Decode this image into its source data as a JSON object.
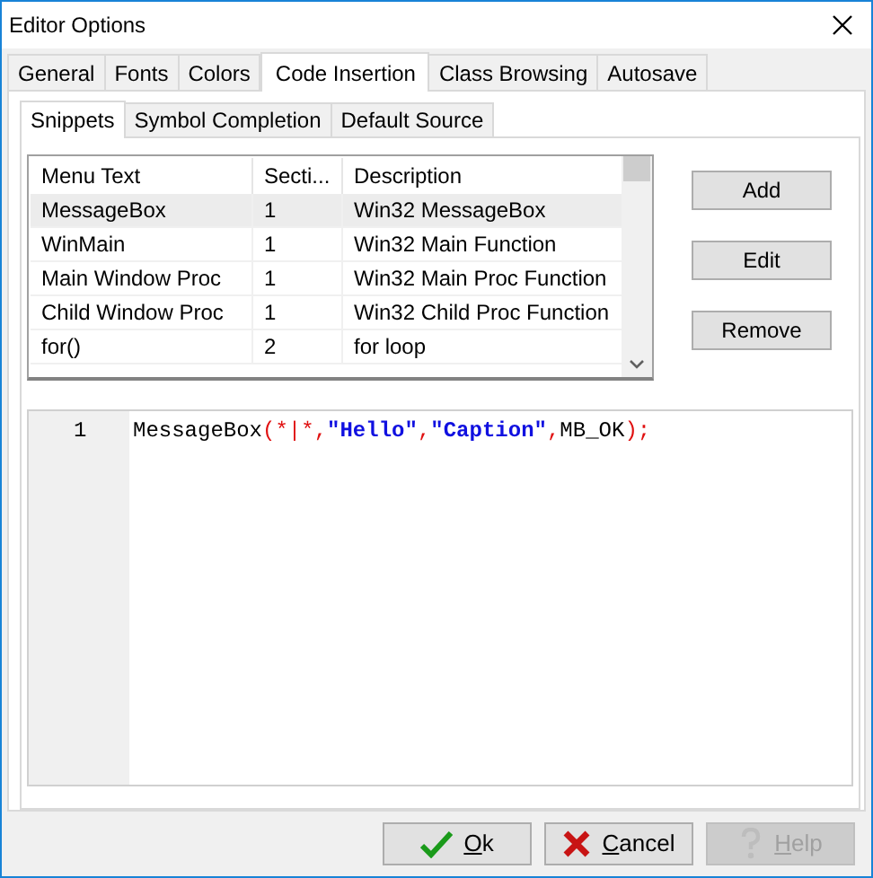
{
  "window": {
    "title": "Editor Options"
  },
  "tabs": [
    {
      "label": "General",
      "selected": false
    },
    {
      "label": "Fonts",
      "selected": false
    },
    {
      "label": "Colors",
      "selected": false
    },
    {
      "label": "Code Insertion",
      "selected": true
    },
    {
      "label": "Class Browsing",
      "selected": false
    },
    {
      "label": "Autosave",
      "selected": false
    }
  ],
  "subtabs": [
    {
      "label": "Snippets",
      "selected": true
    },
    {
      "label": "Symbol Completion",
      "selected": false
    },
    {
      "label": "Default Source",
      "selected": false
    }
  ],
  "table": {
    "columns": [
      "Menu Text",
      "Secti...",
      "Description"
    ],
    "rows": [
      {
        "cells": [
          "MessageBox",
          "1",
          "Win32 MessageBox"
        ],
        "selected": true
      },
      {
        "cells": [
          "WinMain",
          "1",
          "Win32 Main Function"
        ],
        "selected": false
      },
      {
        "cells": [
          "Main Window Proc",
          "1",
          "Win32 Main Proc Function"
        ],
        "selected": false
      },
      {
        "cells": [
          "Child Window Proc",
          "1",
          "Win32 Child Proc Function"
        ],
        "selected": false
      },
      {
        "cells": [
          "for()",
          "2",
          "for loop"
        ],
        "selected": false
      }
    ]
  },
  "side_buttons": [
    "Add",
    "Edit",
    "Remove"
  ],
  "editor": {
    "lines": [
      {
        "number": "1",
        "tokens": [
          {
            "kind": "ident",
            "text": "MessageBox"
          },
          {
            "kind": "symbol",
            "text": "(*|*,"
          },
          {
            "kind": "string",
            "text": "\"Hello\""
          },
          {
            "kind": "symbol",
            "text": ","
          },
          {
            "kind": "string",
            "text": "\"Caption\""
          },
          {
            "kind": "symbol",
            "text": ","
          },
          {
            "kind": "ident",
            "text": "MB_OK"
          },
          {
            "kind": "symbol",
            "text": ");"
          }
        ]
      }
    ]
  },
  "buttons": [
    {
      "kind": "ok",
      "label": "Ok",
      "disabled": false
    },
    {
      "kind": "cancel",
      "label": "Cancel",
      "disabled": false
    },
    {
      "kind": "help",
      "label": "Help",
      "disabled": true
    }
  ]
}
